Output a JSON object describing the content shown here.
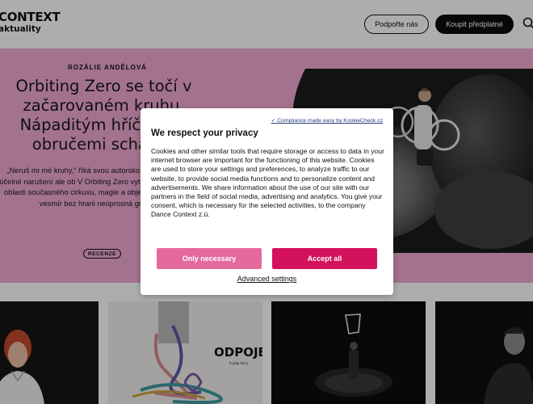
{
  "header": {
    "logo_line1": "CONTEXT",
    "logo_line2": "aktuality",
    "support_label": "Podpořte nás",
    "subscribe_label": "Koupit předplatné",
    "search_icon": "search-icon"
  },
  "hero": {
    "author": "ROZÁLIE ANDĚLOVÁ",
    "title": "Orbiting Zero se točí v začarovaném kruhu. Nápaditým hříčkám s obručemi schází g",
    "excerpt": "„Neruš mi mé kruhy,“ říká svou autorsko Hrdlička. Drobné, účelné narušení ale ob V Orbiting Zero vytváří performer, tvůrc oblasti současného cirkusu, magie a objektem svůj magický vesmír bez hrani neúprosná gravitace.",
    "tag": "RECENZE",
    "background_color": "#f1a9d3"
  },
  "thumbnails": {
    "t2_title": "ODPOJE",
    "t2_subtitle": "A jaký má p"
  },
  "cookie_modal": {
    "compliance_link": "✓ Compliance made easy by KookieCheck.cz",
    "title": "We respect your privacy",
    "body": "Cookies and other similar tools that require storage or access to data in your internet browser are important for the functioning of this website. Cookies are used to store your settings and preferences, to analyze traffic to our website, to provide social media functions and to personalize content and advertisements. We share information about the use of our site with our partners in the field of social media, advertising and analytics. You give your consent, which is necessary for the selected activities, to the company Dance Context z.ú.",
    "only_necessary_label": "Only necessary",
    "accept_all_label": "Accept all",
    "advanced_label": "Advanced settings",
    "accent_color": "#d4125c",
    "secondary_color": "#e46a9e"
  }
}
